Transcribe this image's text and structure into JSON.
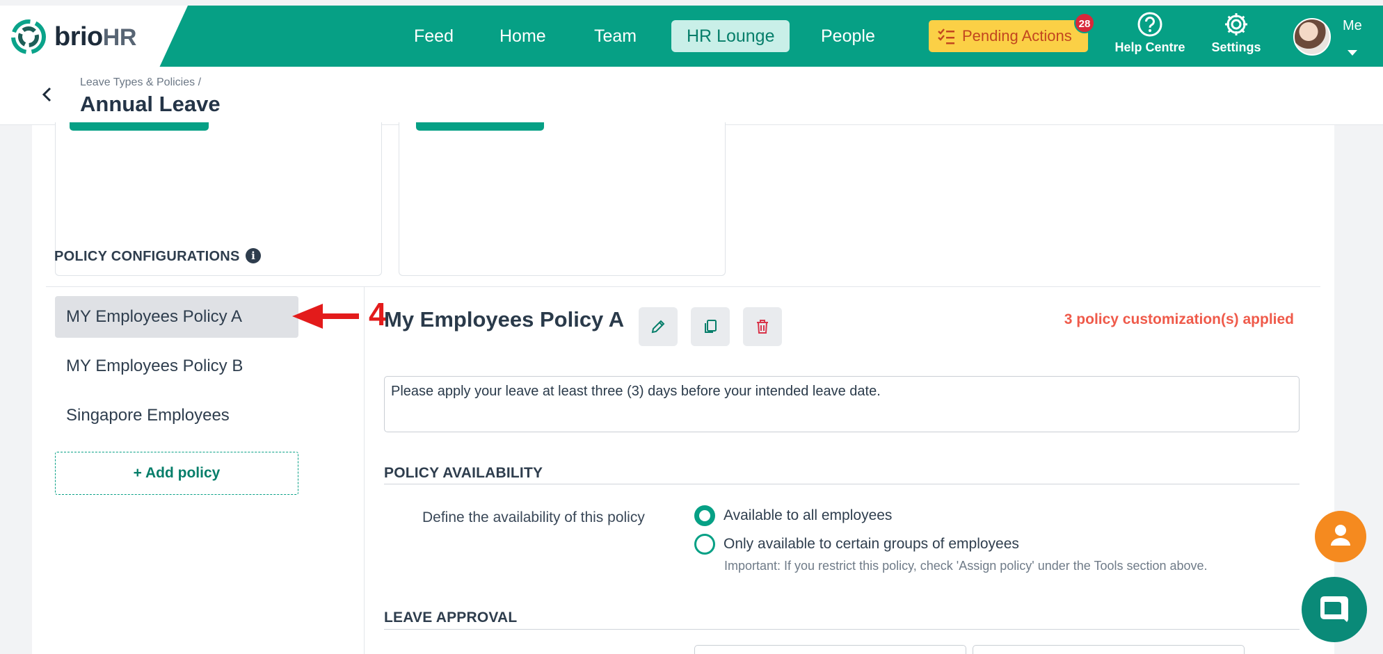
{
  "brand": {
    "name_main": "brio",
    "name_suffix": "HR"
  },
  "nav": {
    "items": [
      {
        "label": "Feed"
      },
      {
        "label": "Home"
      },
      {
        "label": "Team"
      },
      {
        "label": "HR Lounge",
        "active": true
      },
      {
        "label": "People"
      }
    ],
    "pending": {
      "label": "Pending Actions",
      "count": "28"
    },
    "help": {
      "label": "Help Centre"
    },
    "settings": {
      "label": "Settings"
    },
    "user": {
      "label": "Me"
    }
  },
  "header": {
    "breadcrumb": "Leave Types & Policies",
    "breadcrumb_sep": "/",
    "title": "Annual Leave"
  },
  "policy_config": {
    "section_title": "POLICY CONFIGURATIONS",
    "policies": [
      {
        "label": "MY Employees Policy A",
        "selected": true
      },
      {
        "label": "MY Employees Policy B"
      },
      {
        "label": "Singapore Employees"
      }
    ],
    "add_label": "+ Add policy",
    "annotation_number": "4"
  },
  "policy_detail": {
    "name": "My Employees Policy A",
    "customizations": "3 policy customization(s) applied",
    "description": "Please apply your leave at least three (3) days before your intended leave date.",
    "availability": {
      "heading": "POLICY AVAILABILITY",
      "label": "Define the availability of this policy",
      "options": [
        {
          "label": "Available to all employees",
          "checked": true
        },
        {
          "label": "Only available to certain groups of employees",
          "checked": false
        }
      ],
      "note": "Important: If you restrict this policy, check 'Assign policy' under the Tools section above."
    },
    "approval": {
      "heading": "LEAVE APPROVAL"
    }
  },
  "colors": {
    "brand_green": "#06a085",
    "pending_yellow": "#fbd046",
    "alert_red": "#ef5a4a",
    "fab_orange": "#f58a1f"
  },
  "icons": [
    "brio-logo-icon",
    "checklist-icon",
    "help-circle-icon",
    "gear-icon",
    "chevron-left-icon",
    "info-icon",
    "pencil-icon",
    "copy-icon",
    "trash-icon",
    "person-icon",
    "chat-icon"
  ]
}
